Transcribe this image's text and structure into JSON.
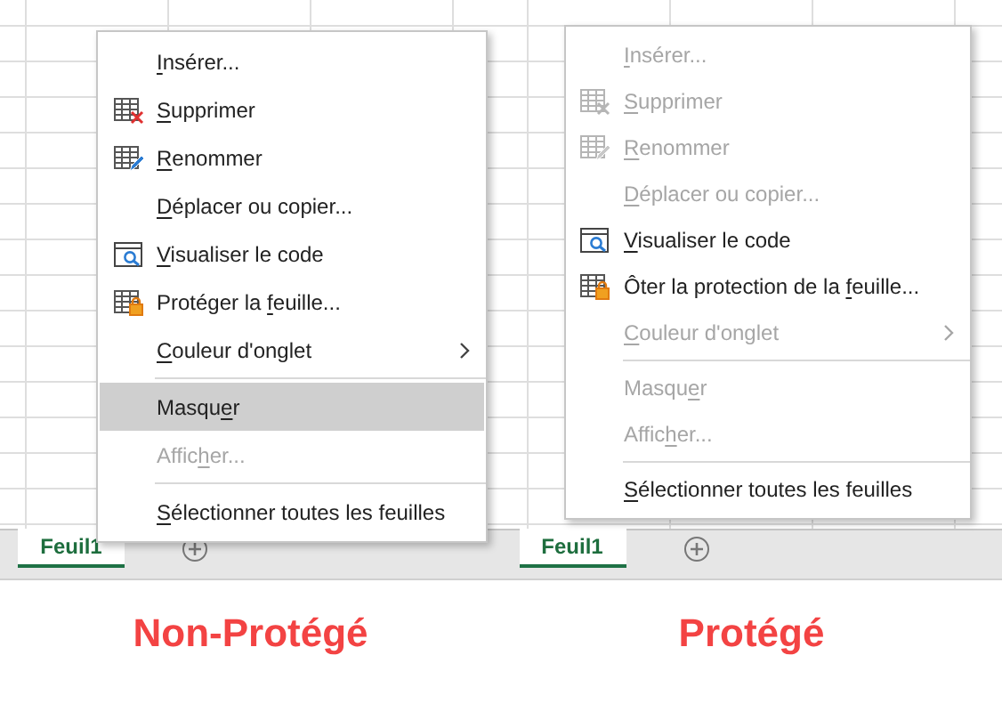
{
  "panels": [
    {
      "sheet_tab": {
        "label": "Feuil1",
        "selected": true
      },
      "caption": "Non-Protégé",
      "menu": [
        {
          "kind": "plain",
          "key": "I",
          "post": "nsérer...",
          "disabled": false,
          "highlighted": false
        },
        {
          "kind": "delete",
          "key": "S",
          "post": "upprimer",
          "disabled": false,
          "highlighted": false
        },
        {
          "kind": "rename",
          "key": "R",
          "post": "enommer",
          "disabled": false,
          "highlighted": false
        },
        {
          "kind": "plain",
          "key": "D",
          "post": "éplacer ou copier...",
          "disabled": false,
          "highlighted": false
        },
        {
          "kind": "code",
          "key": "V",
          "post": "isualiser le code",
          "disabled": false,
          "highlighted": false
        },
        {
          "kind": "lock",
          "pre": "Protéger la ",
          "key": "f",
          "post": "euille...",
          "disabled": false,
          "highlighted": false
        },
        {
          "kind": "submenu",
          "key": "C",
          "post": "ouleur d'onglet",
          "disabled": false,
          "highlighted": false
        },
        {
          "kind": "separator"
        },
        {
          "kind": "plain",
          "pre": "Masqu",
          "key": "e",
          "post": "r",
          "disabled": false,
          "highlighted": true
        },
        {
          "kind": "plain",
          "pre": "Affic",
          "key": "h",
          "post": "er...",
          "disabled": true,
          "highlighted": false
        },
        {
          "kind": "separator"
        },
        {
          "kind": "plain",
          "key": "S",
          "post": "électionner toutes les feuilles",
          "disabled": false,
          "highlighted": false
        }
      ]
    },
    {
      "sheet_tab": {
        "label": "Feuil1",
        "selected": true
      },
      "caption": "Protégé",
      "menu": [
        {
          "kind": "plain",
          "key": "I",
          "post": "nsérer...",
          "disabled": true,
          "highlighted": false
        },
        {
          "kind": "delete",
          "key": "S",
          "post": "upprimer",
          "disabled": true,
          "highlighted": false
        },
        {
          "kind": "rename",
          "key": "R",
          "post": "enommer",
          "disabled": true,
          "highlighted": false
        },
        {
          "kind": "plain",
          "key": "D",
          "post": "éplacer ou copier...",
          "disabled": true,
          "highlighted": false
        },
        {
          "kind": "code",
          "key": "V",
          "post": "isualiser le code",
          "disabled": false,
          "highlighted": false
        },
        {
          "kind": "lock",
          "pre": "Ôter la protection de la ",
          "key": "f",
          "post": "euille...",
          "disabled": false,
          "highlighted": false
        },
        {
          "kind": "submenu",
          "key": "C",
          "post": "ouleur d'onglet",
          "disabled": true,
          "highlighted": false
        },
        {
          "kind": "separator"
        },
        {
          "kind": "plain",
          "pre": "Masqu",
          "key": "e",
          "post": "r",
          "disabled": true,
          "highlighted": false
        },
        {
          "kind": "plain",
          "pre": "Affic",
          "key": "h",
          "post": "er...",
          "disabled": true,
          "highlighted": false
        },
        {
          "kind": "separator"
        },
        {
          "kind": "plain",
          "key": "S",
          "post": "électionner toutes les feuilles",
          "disabled": false,
          "highlighted": false
        }
      ]
    }
  ]
}
